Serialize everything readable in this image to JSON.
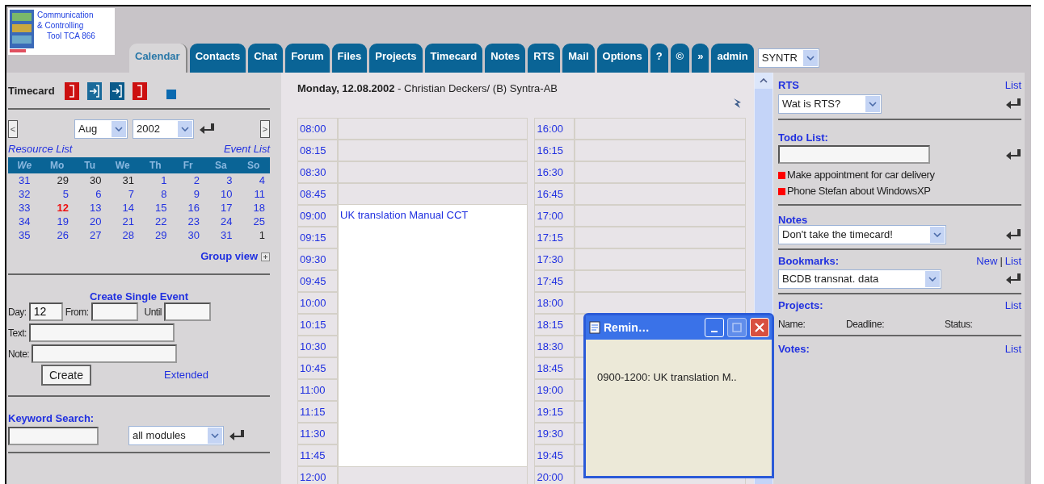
{
  "logo": {
    "lines": [
      "Communication",
      "& Controlling",
      "Tool TCA 866"
    ]
  },
  "tabs": [
    {
      "label": "Calendar",
      "selected": true
    },
    {
      "label": "Contacts",
      "selected": false
    },
    {
      "label": "Chat",
      "selected": false
    },
    {
      "label": "Forum",
      "selected": false
    },
    {
      "label": "Files",
      "selected": false
    },
    {
      "label": "Projects",
      "selected": false
    },
    {
      "label": "Timecard",
      "selected": false
    },
    {
      "label": "Notes",
      "selected": false
    },
    {
      "label": "RTS",
      "selected": false
    },
    {
      "label": "Mail",
      "selected": false
    },
    {
      "label": "Options",
      "selected": false
    },
    {
      "label": "?",
      "selected": false
    },
    {
      "label": "©",
      "selected": false
    },
    {
      "label": "»",
      "selected": false
    },
    {
      "label": "admin",
      "selected": false
    }
  ],
  "site_select": {
    "value": "SYNTR"
  },
  "timecard": {
    "title": "Timecard",
    "buttons": [
      {
        "kind": "stop",
        "color": "#cc1010"
      },
      {
        "kind": "enter",
        "color": "#1a6a9a"
      },
      {
        "kind": "enter",
        "color": "#0a5a8a"
      },
      {
        "kind": "stop",
        "color": "#cc1010"
      },
      {
        "kind": "square",
        "color": "#0a6ab0"
      }
    ]
  },
  "mini_calendar": {
    "prev_label": "<",
    "next_label": ">",
    "month": "Aug",
    "year": "2002",
    "resource_link": "Resource List",
    "event_link": "Event List",
    "header": [
      "We",
      "Mo",
      "Tu",
      "We",
      "Th",
      "Fr",
      "Sa",
      "So"
    ],
    "weeks": [
      {
        "week": "31",
        "days": [
          {
            "label": "29",
            "kind": "other"
          },
          {
            "label": "30",
            "kind": "other"
          },
          {
            "label": "31",
            "kind": "other"
          },
          {
            "label": "1",
            "kind": "normal"
          },
          {
            "label": "2",
            "kind": "normal"
          },
          {
            "label": "3",
            "kind": "normal"
          },
          {
            "label": "4",
            "kind": "normal"
          }
        ]
      },
      {
        "week": "32",
        "days": [
          {
            "label": "5",
            "kind": "normal"
          },
          {
            "label": "6",
            "kind": "normal"
          },
          {
            "label": "7",
            "kind": "normal"
          },
          {
            "label": "8",
            "kind": "normal"
          },
          {
            "label": "9",
            "kind": "normal"
          },
          {
            "label": "10",
            "kind": "normal"
          },
          {
            "label": "11",
            "kind": "normal"
          }
        ]
      },
      {
        "week": "33",
        "days": [
          {
            "label": "12",
            "kind": "today"
          },
          {
            "label": "13",
            "kind": "normal"
          },
          {
            "label": "14",
            "kind": "normal"
          },
          {
            "label": "15",
            "kind": "normal"
          },
          {
            "label": "16",
            "kind": "normal"
          },
          {
            "label": "17",
            "kind": "normal"
          },
          {
            "label": "18",
            "kind": "normal"
          }
        ]
      },
      {
        "week": "34",
        "days": [
          {
            "label": "19",
            "kind": "normal"
          },
          {
            "label": "20",
            "kind": "normal"
          },
          {
            "label": "21",
            "kind": "normal"
          },
          {
            "label": "22",
            "kind": "normal"
          },
          {
            "label": "23",
            "kind": "normal"
          },
          {
            "label": "24",
            "kind": "normal"
          },
          {
            "label": "25",
            "kind": "normal"
          }
        ]
      },
      {
        "week": "35",
        "days": [
          {
            "label": "26",
            "kind": "normal"
          },
          {
            "label": "27",
            "kind": "normal"
          },
          {
            "label": "28",
            "kind": "normal"
          },
          {
            "label": "29",
            "kind": "normal"
          },
          {
            "label": "30",
            "kind": "normal"
          },
          {
            "label": "31",
            "kind": "normal"
          },
          {
            "label": "1",
            "kind": "other"
          }
        ]
      }
    ],
    "group_view": "Group view"
  },
  "event_form": {
    "title": "Create Single Event",
    "day": {
      "label": "Day:",
      "value": "12"
    },
    "from": {
      "label": "From:"
    },
    "until": {
      "label": "Until"
    },
    "text": {
      "label": "Text:"
    },
    "note": {
      "label": "Note:"
    },
    "button": "Create",
    "link": "Extended"
  },
  "keyword_search": {
    "title": "Keyword Search:",
    "scope": "all modules"
  },
  "day_view": {
    "heading": "**Monday, 12.08.2002** - Christian Deckers/ (B) Syntra-AB",
    "columns": [
      {
        "slots": [
          {
            "time": "08:00",
            "booked": false
          },
          {
            "time": "08:15",
            "booked": false
          },
          {
            "time": "08:30",
            "booked": false
          },
          {
            "time": "08:45",
            "booked": false
          },
          {
            "time": "09:00",
            "booked": true,
            "event": "UK translation Manual CCT"
          },
          {
            "time": "09:15",
            "booked": true
          },
          {
            "time": "09:30",
            "booked": true
          },
          {
            "time": "09:45",
            "booked": true
          },
          {
            "time": "10:00",
            "booked": true
          },
          {
            "time": "10:15",
            "booked": true
          },
          {
            "time": "10:30",
            "booked": true
          },
          {
            "time": "10:45",
            "booked": true
          },
          {
            "time": "11:00",
            "booked": true
          },
          {
            "time": "11:15",
            "booked": true
          },
          {
            "time": "11:30",
            "booked": true
          },
          {
            "time": "11:45",
            "booked": true
          },
          {
            "time": "12:00",
            "booked": false
          }
        ]
      },
      {
        "slots": [
          {
            "time": "16:00",
            "booked": false
          },
          {
            "time": "16:15",
            "booked": false
          },
          {
            "time": "16:30",
            "booked": false
          },
          {
            "time": "16:45",
            "booked": false
          },
          {
            "time": "17:00",
            "booked": false
          },
          {
            "time": "17:15",
            "booked": false
          },
          {
            "time": "17:30",
            "booked": false
          },
          {
            "time": "17:45",
            "booked": false
          },
          {
            "time": "18:00",
            "booked": false
          },
          {
            "time": "18:15",
            "booked": false
          },
          {
            "time": "18:30",
            "booked": false
          },
          {
            "time": "18:45",
            "booked": false
          },
          {
            "time": "19:00",
            "booked": false
          },
          {
            "time": "19:15",
            "booked": false
          },
          {
            "time": "19:30",
            "booked": false
          },
          {
            "time": "19:45",
            "booked": false
          },
          {
            "time": "20:00",
            "booked": false
          }
        ]
      }
    ]
  },
  "right_panel": {
    "rts": {
      "title": "RTS",
      "link": "List",
      "select": "Wat is RTS?"
    },
    "todo": {
      "title": "Todo List:",
      "items": [
        {
          "text": "Make appointment for car delivery",
          "color": "#ff0000"
        },
        {
          "text": "Phone Stefan about WindowsXP",
          "color": "#ff0000"
        }
      ]
    },
    "notes": {
      "title": "Notes",
      "select": "Don't take the timecard!"
    },
    "bookmarks": {
      "title": "Bookmarks:",
      "new_link": "New",
      "separator": "|",
      "list_link": "List",
      "select": "BCDB transnat. data"
    },
    "projects": {
      "title": "Projects:",
      "link": "List",
      "columns": [
        "Name:",
        "Deadline:",
        "Status:"
      ]
    },
    "votes": {
      "title": "Votes:",
      "link": "List"
    }
  },
  "reminder": {
    "title": "Remin…",
    "message": "0900-1200: UK translation M..",
    "buttons": [
      {
        "kind": "minimize",
        "disabled": false
      },
      {
        "kind": "maximize",
        "disabled": true
      },
      {
        "kind": "close",
        "disabled": false
      }
    ]
  }
}
